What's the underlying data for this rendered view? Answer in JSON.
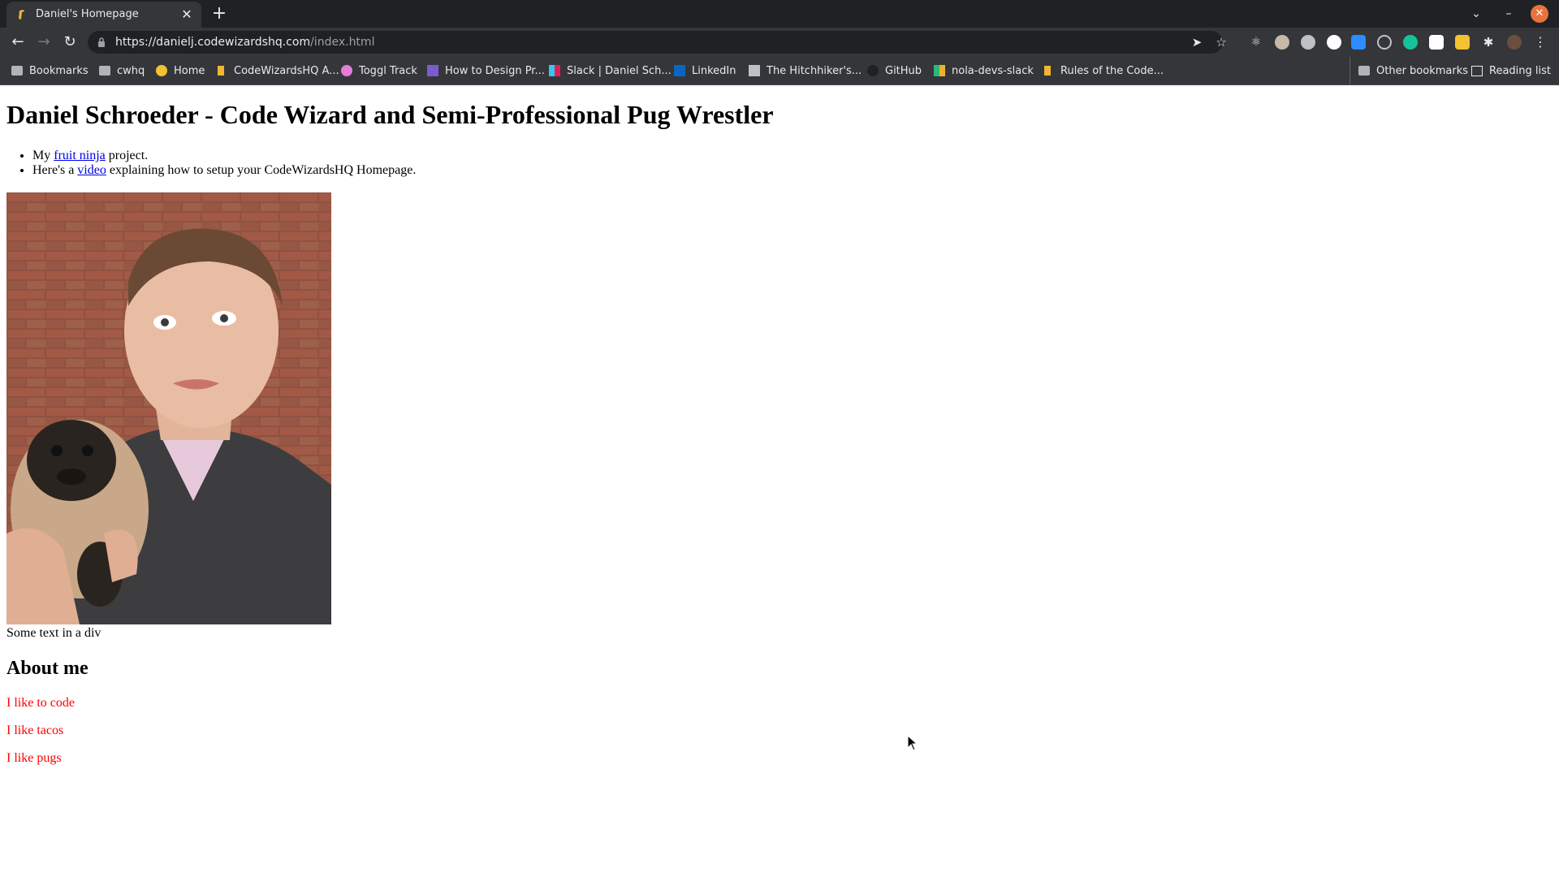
{
  "browser": {
    "tab": {
      "title": "Daniel's Homepage"
    },
    "url": {
      "host": "https://danielj.codewizardshq.com",
      "path": "/index.html"
    },
    "bookmarks": [
      {
        "label": "Bookmarks",
        "icon": "folder-icon"
      },
      {
        "label": "cwhq",
        "icon": "folder-icon"
      },
      {
        "label": "Home",
        "icon": "home-favicon"
      },
      {
        "label": "CodeWizardsHQ A...",
        "icon": "codewizards-favicon"
      },
      {
        "label": "Toggl Track",
        "icon": "toggl-favicon"
      },
      {
        "label": "How to Design Pr...",
        "icon": "design-favicon"
      },
      {
        "label": "Slack | Daniel Sch...",
        "icon": "slack-favicon"
      },
      {
        "label": "LinkedIn",
        "icon": "linkedin-favicon"
      },
      {
        "label": "The Hitchhiker's...",
        "icon": "book-favicon"
      },
      {
        "label": "GitHub",
        "icon": "github-favicon"
      },
      {
        "label": "nola-devs-slack",
        "icon": "slack-favicon"
      },
      {
        "label": "Rules of the Code...",
        "icon": "codewizards-favicon"
      }
    ],
    "other_bookmarks": "Other bookmarks",
    "reading_list": "Reading list",
    "colors": {
      "chrome_dark": "#202124",
      "chrome": "#35363a",
      "close_button": "#e8743b"
    }
  },
  "page": {
    "heading": "Daniel Schroeder - Code Wizard and Semi-Professional Pug Wrestler",
    "list": [
      {
        "before": "My ",
        "link": "fruit ninja",
        "after": " project."
      },
      {
        "before": "Here's a ",
        "link": "video",
        "after": " explaining how to setup your CodeWizardsHQ Homepage."
      }
    ],
    "div_text": "Some text in a div",
    "about_heading": "About me",
    "about_items": [
      "I like to code",
      "I like tacos",
      "I like pugs"
    ],
    "colors": {
      "link": "#0000ee",
      "about_text": "#ff0000"
    }
  }
}
